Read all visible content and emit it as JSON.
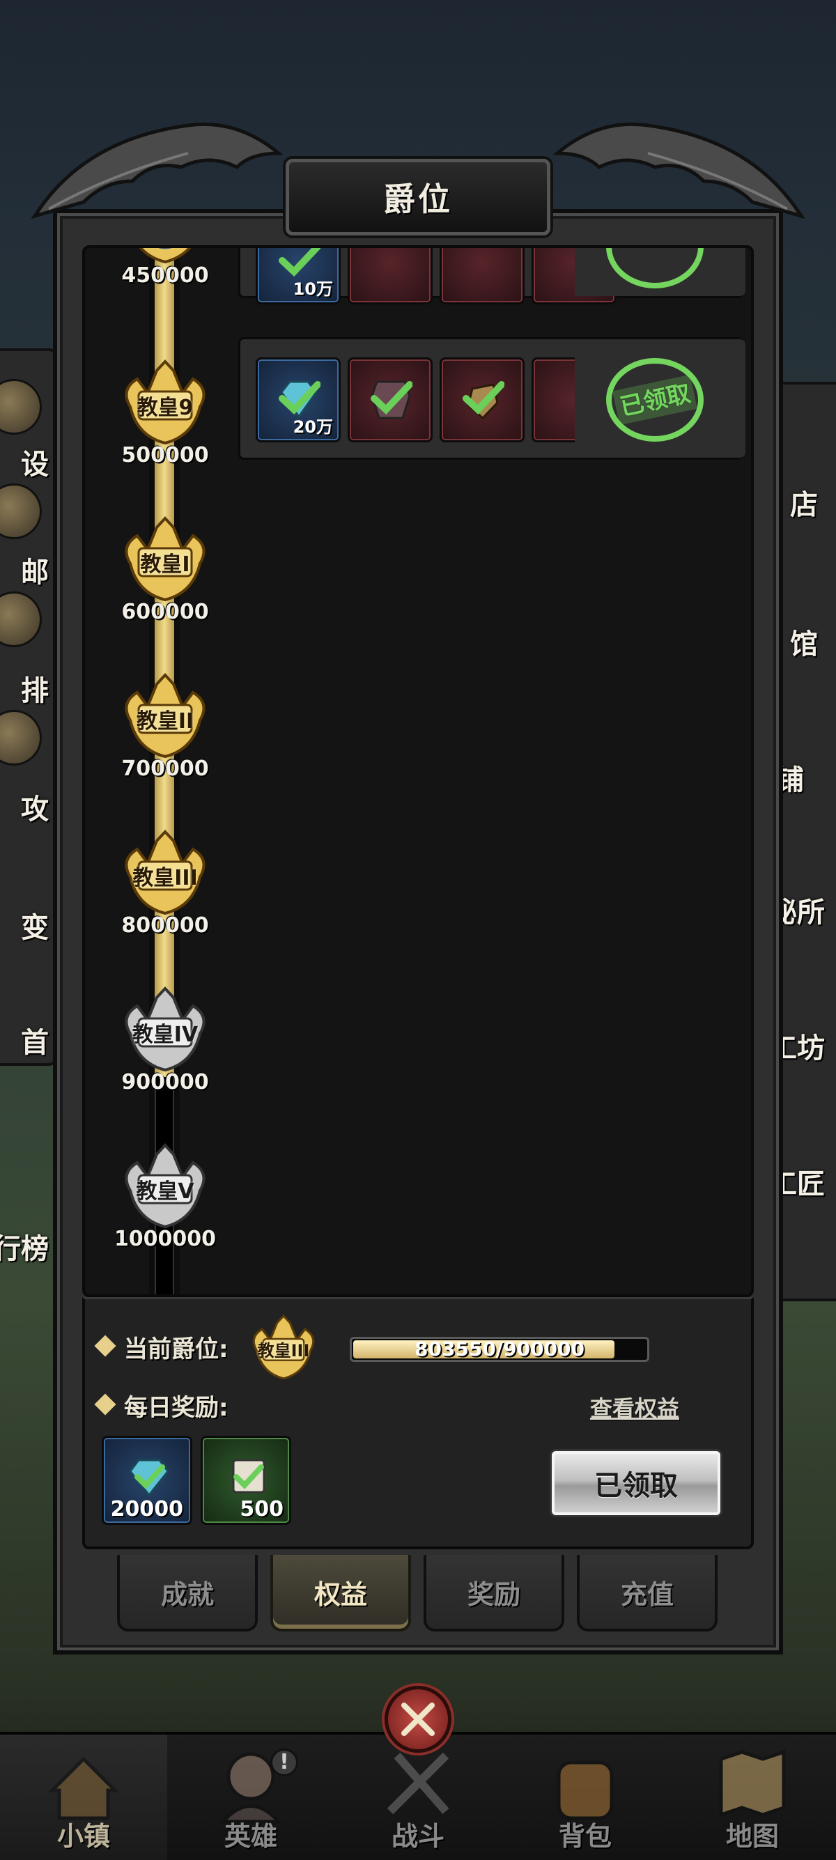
{
  "modal": {
    "title": "爵位"
  },
  "background_labels": {
    "left": [
      "设",
      "邮",
      "排",
      "攻",
      "变",
      "首",
      "行榜"
    ],
    "right": [
      "店",
      "馆",
      "铺",
      "秘所",
      "工坊",
      "工匠"
    ]
  },
  "ranks": [
    {
      "label": "",
      "threshold": "450000",
      "tier": "gold"
    },
    {
      "label": "教皇9",
      "threshold": "500000",
      "tier": "gold"
    },
    {
      "label": "教皇I",
      "threshold": "600000",
      "tier": "gold"
    },
    {
      "label": "教皇II",
      "threshold": "700000",
      "tier": "gold"
    },
    {
      "label": "教皇III",
      "threshold": "800000",
      "tier": "gold"
    },
    {
      "label": "教皇IV",
      "threshold": "900000",
      "tier": "silver"
    },
    {
      "label": "教皇V",
      "threshold": "1000000",
      "tier": "silver"
    }
  ],
  "reward_rows": [
    {
      "first_qty": "10万",
      "stamp": "已领取"
    },
    {
      "first_qty": "20万",
      "stamp": "已领取"
    }
  ],
  "current": {
    "label": "当前爵位:",
    "badge_label": "教皇III",
    "progress_text": "803550/900000",
    "progress_fraction": 0.893
  },
  "daily": {
    "label": "每日奖励:",
    "view_link": "查看权益",
    "rewards": [
      {
        "qty": "20000",
        "icon": "diamond-icon"
      },
      {
        "qty": "500",
        "icon": "scroll-icon"
      }
    ],
    "claim_button": "已领取"
  },
  "tabs": [
    {
      "label": "成就",
      "active": false
    },
    {
      "label": "权益",
      "active": true
    },
    {
      "label": "奖励",
      "active": false
    },
    {
      "label": "充值",
      "active": false
    }
  ],
  "bottom_nav": [
    {
      "label": "小镇",
      "active": true,
      "icon": "town-icon"
    },
    {
      "label": "英雄",
      "active": false,
      "icon": "hero-icon",
      "alert": "!"
    },
    {
      "label": "战斗",
      "active": false,
      "icon": "battle-icon"
    },
    {
      "label": "背包",
      "active": false,
      "icon": "backpack-icon"
    },
    {
      "label": "地图",
      "active": false,
      "icon": "map-icon"
    }
  ],
  "colors": {
    "gold": "#f0dc8c",
    "stamp_green": "#74d65f",
    "panel": "#141414"
  }
}
